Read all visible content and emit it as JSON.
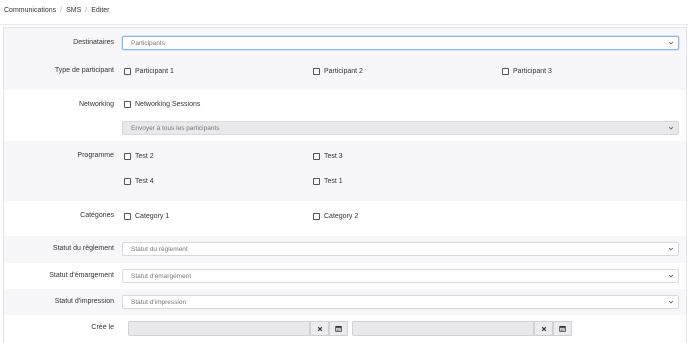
{
  "breadcrumb": {
    "items": [
      "Communications",
      "SMS",
      "Editer"
    ]
  },
  "form": {
    "destinataires": {
      "label": "Destinataires",
      "value": "Participants"
    },
    "type_participant": {
      "label": "Type de participant",
      "options": [
        "Participant 1",
        "Participant 2",
        "Participant 3"
      ]
    },
    "networking": {
      "label": "Networking",
      "checkbox": "Networking Sessions",
      "select_value": "Envoyer à tous les participants"
    },
    "programme": {
      "label": "Programme",
      "options": [
        "Test 2",
        "Test 3",
        "Test 4",
        "Test 1"
      ]
    },
    "categories": {
      "label": "Catégories",
      "options": [
        "Category 1",
        "Category 2"
      ]
    },
    "statut_reglement": {
      "label": "Statut du règlement",
      "placeholder": "Statut du règlement"
    },
    "statut_emargement": {
      "label": "Statut d'émargement",
      "placeholder": "Statut d'émargement"
    },
    "statut_impression": {
      "label": "Statut d'impression",
      "placeholder": "Statut d'impression"
    },
    "cree_le": {
      "label": "Crée le",
      "from_value": "",
      "to_value": ""
    }
  },
  "icons": {
    "clear": "×",
    "calendar": "calendar-icon",
    "chevron": "chevron-down-icon"
  },
  "colors": {
    "focus_border": "#8bb6e8",
    "row_gray": "#f7f7f9",
    "disabled_bg": "#e9e9ec"
  }
}
